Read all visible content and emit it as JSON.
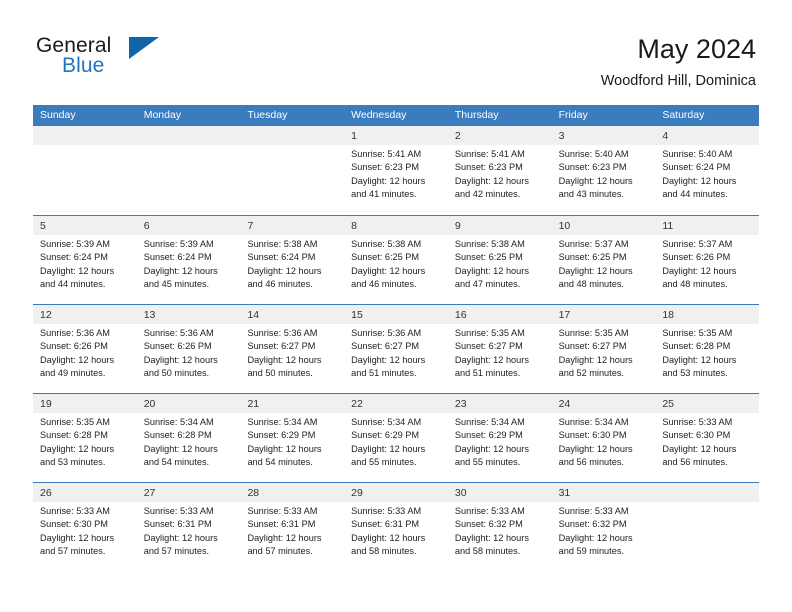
{
  "brand": {
    "general": "General",
    "blue": "Blue",
    "triangle_color": "#1064a8",
    "blue_color": "#2077c0"
  },
  "header": {
    "title": "May 2024",
    "subtitle": "Woodford Hill, Dominica"
  },
  "theme": {
    "header_bar": "#3a7cbe",
    "day_band": "#f0f0f0",
    "text": "#222222"
  },
  "weekdays": [
    "Sunday",
    "Monday",
    "Tuesday",
    "Wednesday",
    "Thursday",
    "Friday",
    "Saturday"
  ],
  "weeks": [
    [
      {
        "day": "",
        "empty": true
      },
      {
        "day": "",
        "empty": true
      },
      {
        "day": "",
        "empty": true
      },
      {
        "day": "1",
        "sunrise": "Sunrise: 5:41 AM",
        "sunset": "Sunset: 6:23 PM",
        "daylight1": "Daylight: 12 hours",
        "daylight2": "and 41 minutes."
      },
      {
        "day": "2",
        "sunrise": "Sunrise: 5:41 AM",
        "sunset": "Sunset: 6:23 PM",
        "daylight1": "Daylight: 12 hours",
        "daylight2": "and 42 minutes."
      },
      {
        "day": "3",
        "sunrise": "Sunrise: 5:40 AM",
        "sunset": "Sunset: 6:23 PM",
        "daylight1": "Daylight: 12 hours",
        "daylight2": "and 43 minutes."
      },
      {
        "day": "4",
        "sunrise": "Sunrise: 5:40 AM",
        "sunset": "Sunset: 6:24 PM",
        "daylight1": "Daylight: 12 hours",
        "daylight2": "and 44 minutes."
      }
    ],
    [
      {
        "day": "5",
        "sunrise": "Sunrise: 5:39 AM",
        "sunset": "Sunset: 6:24 PM",
        "daylight1": "Daylight: 12 hours",
        "daylight2": "and 44 minutes."
      },
      {
        "day": "6",
        "sunrise": "Sunrise: 5:39 AM",
        "sunset": "Sunset: 6:24 PM",
        "daylight1": "Daylight: 12 hours",
        "daylight2": "and 45 minutes."
      },
      {
        "day": "7",
        "sunrise": "Sunrise: 5:38 AM",
        "sunset": "Sunset: 6:24 PM",
        "daylight1": "Daylight: 12 hours",
        "daylight2": "and 46 minutes."
      },
      {
        "day": "8",
        "sunrise": "Sunrise: 5:38 AM",
        "sunset": "Sunset: 6:25 PM",
        "daylight1": "Daylight: 12 hours",
        "daylight2": "and 46 minutes."
      },
      {
        "day": "9",
        "sunrise": "Sunrise: 5:38 AM",
        "sunset": "Sunset: 6:25 PM",
        "daylight1": "Daylight: 12 hours",
        "daylight2": "and 47 minutes."
      },
      {
        "day": "10",
        "sunrise": "Sunrise: 5:37 AM",
        "sunset": "Sunset: 6:25 PM",
        "daylight1": "Daylight: 12 hours",
        "daylight2": "and 48 minutes."
      },
      {
        "day": "11",
        "sunrise": "Sunrise: 5:37 AM",
        "sunset": "Sunset: 6:26 PM",
        "daylight1": "Daylight: 12 hours",
        "daylight2": "and 48 minutes."
      }
    ],
    [
      {
        "day": "12",
        "sunrise": "Sunrise: 5:36 AM",
        "sunset": "Sunset: 6:26 PM",
        "daylight1": "Daylight: 12 hours",
        "daylight2": "and 49 minutes."
      },
      {
        "day": "13",
        "sunrise": "Sunrise: 5:36 AM",
        "sunset": "Sunset: 6:26 PM",
        "daylight1": "Daylight: 12 hours",
        "daylight2": "and 50 minutes."
      },
      {
        "day": "14",
        "sunrise": "Sunrise: 5:36 AM",
        "sunset": "Sunset: 6:27 PM",
        "daylight1": "Daylight: 12 hours",
        "daylight2": "and 50 minutes."
      },
      {
        "day": "15",
        "sunrise": "Sunrise: 5:36 AM",
        "sunset": "Sunset: 6:27 PM",
        "daylight1": "Daylight: 12 hours",
        "daylight2": "and 51 minutes."
      },
      {
        "day": "16",
        "sunrise": "Sunrise: 5:35 AM",
        "sunset": "Sunset: 6:27 PM",
        "daylight1": "Daylight: 12 hours",
        "daylight2": "and 51 minutes."
      },
      {
        "day": "17",
        "sunrise": "Sunrise: 5:35 AM",
        "sunset": "Sunset: 6:27 PM",
        "daylight1": "Daylight: 12 hours",
        "daylight2": "and 52 minutes."
      },
      {
        "day": "18",
        "sunrise": "Sunrise: 5:35 AM",
        "sunset": "Sunset: 6:28 PM",
        "daylight1": "Daylight: 12 hours",
        "daylight2": "and 53 minutes."
      }
    ],
    [
      {
        "day": "19",
        "sunrise": "Sunrise: 5:35 AM",
        "sunset": "Sunset: 6:28 PM",
        "daylight1": "Daylight: 12 hours",
        "daylight2": "and 53 minutes."
      },
      {
        "day": "20",
        "sunrise": "Sunrise: 5:34 AM",
        "sunset": "Sunset: 6:28 PM",
        "daylight1": "Daylight: 12 hours",
        "daylight2": "and 54 minutes."
      },
      {
        "day": "21",
        "sunrise": "Sunrise: 5:34 AM",
        "sunset": "Sunset: 6:29 PM",
        "daylight1": "Daylight: 12 hours",
        "daylight2": "and 54 minutes."
      },
      {
        "day": "22",
        "sunrise": "Sunrise: 5:34 AM",
        "sunset": "Sunset: 6:29 PM",
        "daylight1": "Daylight: 12 hours",
        "daylight2": "and 55 minutes."
      },
      {
        "day": "23",
        "sunrise": "Sunrise: 5:34 AM",
        "sunset": "Sunset: 6:29 PM",
        "daylight1": "Daylight: 12 hours",
        "daylight2": "and 55 minutes."
      },
      {
        "day": "24",
        "sunrise": "Sunrise: 5:34 AM",
        "sunset": "Sunset: 6:30 PM",
        "daylight1": "Daylight: 12 hours",
        "daylight2": "and 56 minutes."
      },
      {
        "day": "25",
        "sunrise": "Sunrise: 5:33 AM",
        "sunset": "Sunset: 6:30 PM",
        "daylight1": "Daylight: 12 hours",
        "daylight2": "and 56 minutes."
      }
    ],
    [
      {
        "day": "26",
        "sunrise": "Sunrise: 5:33 AM",
        "sunset": "Sunset: 6:30 PM",
        "daylight1": "Daylight: 12 hours",
        "daylight2": "and 57 minutes."
      },
      {
        "day": "27",
        "sunrise": "Sunrise: 5:33 AM",
        "sunset": "Sunset: 6:31 PM",
        "daylight1": "Daylight: 12 hours",
        "daylight2": "and 57 minutes."
      },
      {
        "day": "28",
        "sunrise": "Sunrise: 5:33 AM",
        "sunset": "Sunset: 6:31 PM",
        "daylight1": "Daylight: 12 hours",
        "daylight2": "and 57 minutes."
      },
      {
        "day": "29",
        "sunrise": "Sunrise: 5:33 AM",
        "sunset": "Sunset: 6:31 PM",
        "daylight1": "Daylight: 12 hours",
        "daylight2": "and 58 minutes."
      },
      {
        "day": "30",
        "sunrise": "Sunrise: 5:33 AM",
        "sunset": "Sunset: 6:32 PM",
        "daylight1": "Daylight: 12 hours",
        "daylight2": "and 58 minutes."
      },
      {
        "day": "31",
        "sunrise": "Sunrise: 5:33 AM",
        "sunset": "Sunset: 6:32 PM",
        "daylight1": "Daylight: 12 hours",
        "daylight2": "and 59 minutes."
      },
      {
        "day": "",
        "empty": true
      }
    ]
  ]
}
